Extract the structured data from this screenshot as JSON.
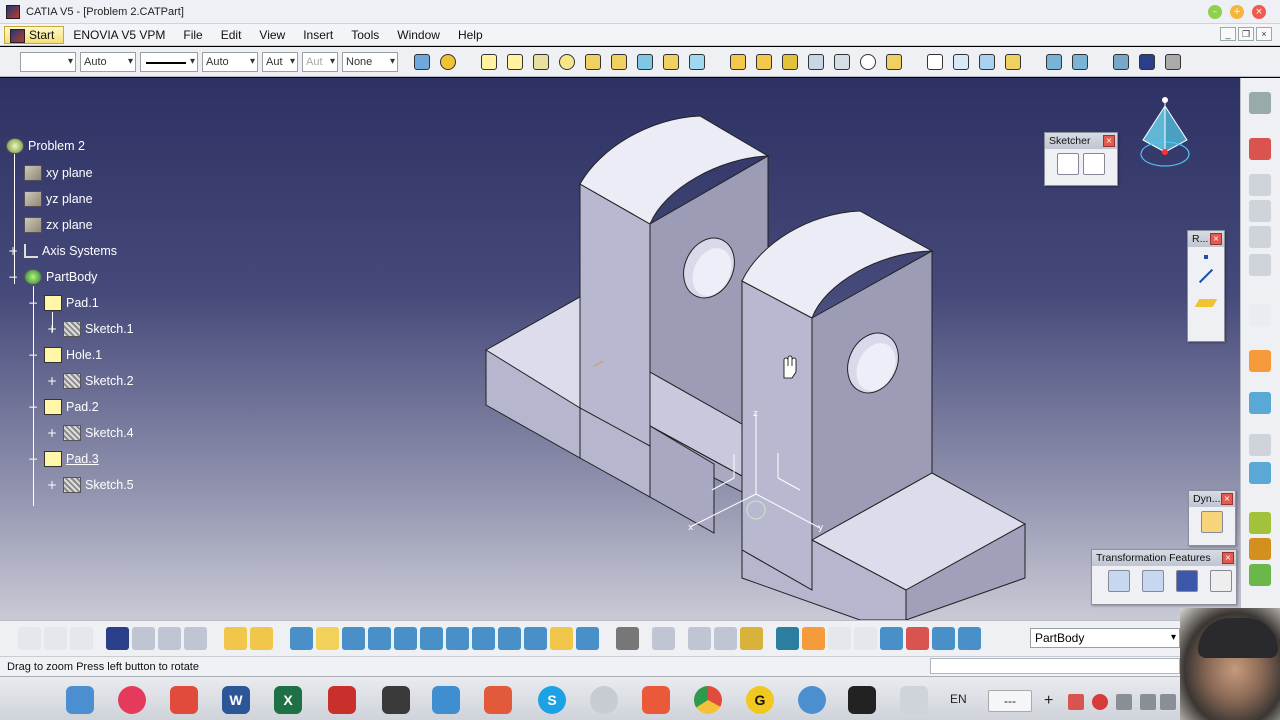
{
  "window": {
    "title": "CATIA V5 - [Problem 2.CATPart]"
  },
  "menubar": {
    "items": [
      "Start",
      "ENOVIA V5 VPM",
      "File",
      "Edit",
      "View",
      "Insert",
      "Tools",
      "Window",
      "Help"
    ]
  },
  "toolbar": {
    "combo_color": "",
    "combo_transparency": "Auto",
    "combo_thickness": "Auto",
    "combo_linetype": "Aut",
    "combo_point": "Aut",
    "combo_layer": "None"
  },
  "tree": {
    "root": "Problem 2",
    "xy": "xy plane",
    "yz": "yz plane",
    "zx": "zx plane",
    "axis": "Axis Systems",
    "partbody": "PartBody",
    "pad1": "Pad.1",
    "sketch1": "Sketch.1",
    "hole1": "Hole.1",
    "sketch2": "Sketch.2",
    "pad2": "Pad.2",
    "sketch4": "Sketch.4",
    "pad3": "Pad.3",
    "sketch5": "Sketch.5"
  },
  "panels": {
    "sketcher": "Sketcher",
    "reference": "R...",
    "dynamic": "Dyn...",
    "transformation": "Transformation Features"
  },
  "compass": {
    "axis_z": "z",
    "axis_x": "x",
    "axis_y": "y"
  },
  "bottom": {
    "current_body": "PartBody"
  },
  "status": {
    "message": "Drag to zoom  Press left button to rotate"
  },
  "taskbar": {
    "lang": "EN",
    "field": "---"
  },
  "colors": {
    "background_top": "#2d3163",
    "background_bottom": "#c9cad6",
    "part_face_light": "#e4e4f2",
    "part_face_mid": "#b4b4cc",
    "part_face_dark": "#8c8ca8"
  }
}
